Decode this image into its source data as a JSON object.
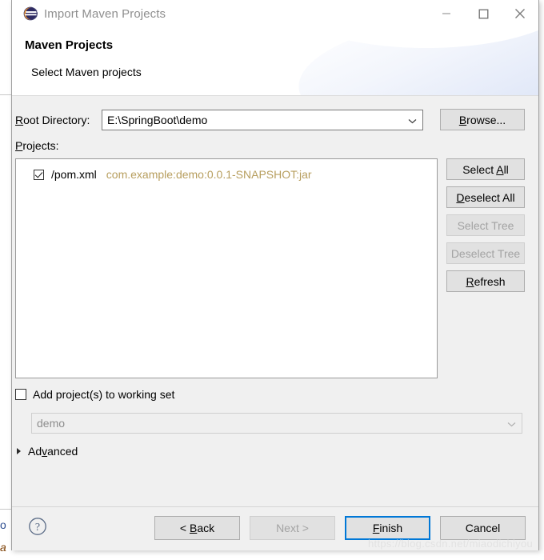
{
  "window": {
    "title": "Import Maven Projects",
    "icon": "maven-icon",
    "controls": {
      "minimize": "minimize-icon",
      "maximize": "maximize-icon",
      "close": "close-icon"
    }
  },
  "header": {
    "title": "Maven Projects",
    "subtitle": "Select Maven projects"
  },
  "form": {
    "root_directory": {
      "label": "Root Directory:",
      "label_mnemonic": "R",
      "value": "E:\\SpringBoot\\demo",
      "browse_label": "Browse...",
      "browse_mnemonic": "B"
    },
    "projects": {
      "label": "Projects:",
      "label_mnemonic": "P",
      "rows": [
        {
          "checked": true,
          "path": "/pom.xml",
          "coordinates": "com.example:demo:0.0.1-SNAPSHOT:jar"
        }
      ]
    },
    "side_buttons": [
      {
        "label": "Select All",
        "mnemonic": "A",
        "enabled": true
      },
      {
        "label": "Deselect All",
        "mnemonic": "D",
        "enabled": true
      },
      {
        "label": "Select Tree",
        "mnemonic": "",
        "enabled": false
      },
      {
        "label": "Deselect Tree",
        "mnemonic": "",
        "enabled": false
      },
      {
        "label": "Refresh",
        "mnemonic": "R",
        "enabled": true
      }
    ],
    "working_set": {
      "checkbox_label": "Add project(s) to working set",
      "checked": false,
      "combo_value": "demo",
      "combo_enabled": false
    },
    "advanced": {
      "label": "Advanced",
      "mnemonic": "v",
      "expanded": false
    }
  },
  "footer": {
    "help_icon": "help-icon",
    "buttons": [
      {
        "label": "< Back",
        "mnemonic": "B",
        "enabled": true,
        "default": false
      },
      {
        "label": "Next >",
        "mnemonic": "N",
        "enabled": false,
        "default": false
      },
      {
        "label": "Finish",
        "mnemonic": "F",
        "enabled": true,
        "default": true
      },
      {
        "label": "Cancel",
        "mnemonic": "",
        "enabled": true,
        "default": false
      }
    ]
  },
  "watermark": "https://blog.csdn.net/miaodichiyou",
  "background": {
    "glyph_top": "o",
    "glyph_bottom": "a"
  },
  "colors": {
    "accent": "#0078d7",
    "coordinate_text": "#b79e5e",
    "dialog_bg": "#f0f0f0",
    "header_bg": "#ffffff",
    "disabled_text": "#a3a3a3"
  }
}
